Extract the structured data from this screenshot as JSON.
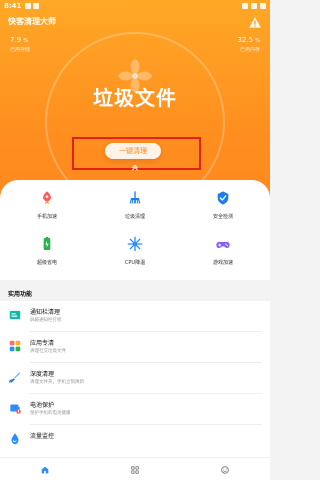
{
  "status_bar": {
    "time": "8:41"
  },
  "header": {
    "app_title": "快客清理大师"
  },
  "stats": {
    "left": {
      "value": "7.9",
      "unit": "%",
      "label": "已用存储"
    },
    "right": {
      "value": "32.5",
      "unit": "%",
      "label": "已用内存"
    }
  },
  "hero": {
    "title": "垃圾文件",
    "button_label": "一键清理"
  },
  "features": [
    {
      "label": "手机加速",
      "icon": "rocket-icon",
      "color": "#ff5b5b"
    },
    {
      "label": "垃圾清理",
      "icon": "broom-icon",
      "color": "#1f7fe6"
    },
    {
      "label": "安全检测",
      "icon": "shield-icon",
      "color": "#1f7fe6"
    },
    {
      "label": "超级省电",
      "icon": "battery-icon",
      "color": "#27b24a"
    },
    {
      "label": "CPU降温",
      "icon": "snowflake-icon",
      "color": "#2b8cff"
    },
    {
      "label": "游戏加速",
      "icon": "gamepad-icon",
      "color": "#8b5cf6"
    }
  ],
  "section": {
    "title": "实用功能"
  },
  "utilities": [
    {
      "title": "通知栏清理",
      "subtitle": "屏蔽通知栏打扰",
      "icon": "notification-icon"
    },
    {
      "title": "应用专清",
      "subtitle": "清理社交垃圾文件",
      "icon": "apps-grid-icon"
    },
    {
      "title": "深度清理",
      "subtitle": "清理文件夹，手机立刻焕新",
      "icon": "brush-icon"
    },
    {
      "title": "电池保护",
      "subtitle": "保护手机的电池健康",
      "icon": "battery-protect-icon"
    },
    {
      "title": "流量监控",
      "subtitle": "",
      "icon": "water-drop-icon"
    }
  ],
  "bottom_nav": [
    {
      "label": "首页",
      "icon": "home-icon",
      "active": true
    },
    {
      "label": "功能",
      "icon": "grid-icon",
      "active": false
    },
    {
      "label": "更多",
      "icon": "smile-icon",
      "active": false
    }
  ],
  "colors": {
    "accent": "#ff8a1f",
    "highlight_box": "#e1211a"
  }
}
